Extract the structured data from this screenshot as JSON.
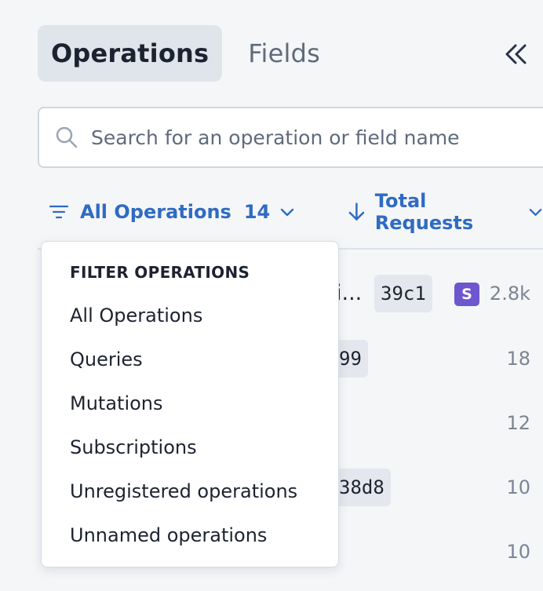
{
  "tabs": [
    {
      "label": "Operations",
      "active": true
    },
    {
      "label": "Fields",
      "active": false
    }
  ],
  "search": {
    "placeholder": "Search for an operation or field name"
  },
  "filter": {
    "label": "All Operations",
    "count": "14"
  },
  "sort": {
    "label": "Total Requests"
  },
  "rows": [
    {
      "name_fragment": "i...",
      "id_fragment": "39c1",
      "badge": "S",
      "count": "2.8k"
    },
    {
      "name_fragment": "",
      "id_fragment": "99",
      "badge": "",
      "count": "18"
    },
    {
      "name_fragment": "",
      "id_fragment": "",
      "badge": "",
      "count": "12"
    },
    {
      "name_fragment": "",
      "id_fragment": "38d8",
      "badge": "",
      "count": "10"
    },
    {
      "name_fragment": "",
      "id_fragment": "",
      "badge": "",
      "count": "10"
    }
  ],
  "dropdown": {
    "heading": "FILTER OPERATIONS",
    "options": [
      "All Operations",
      "Queries",
      "Mutations",
      "Subscriptions",
      "Unregistered operations",
      "Unnamed operations"
    ]
  },
  "colors": {
    "accent": "#2f6bc2",
    "subscription_badge": "#6e56cf",
    "background": "#f4f6f8"
  },
  "icons": {
    "collapse": "double-chevron-left-icon",
    "search": "search-icon",
    "filter": "filter-icon",
    "sort": "arrow-down-icon"
  }
}
